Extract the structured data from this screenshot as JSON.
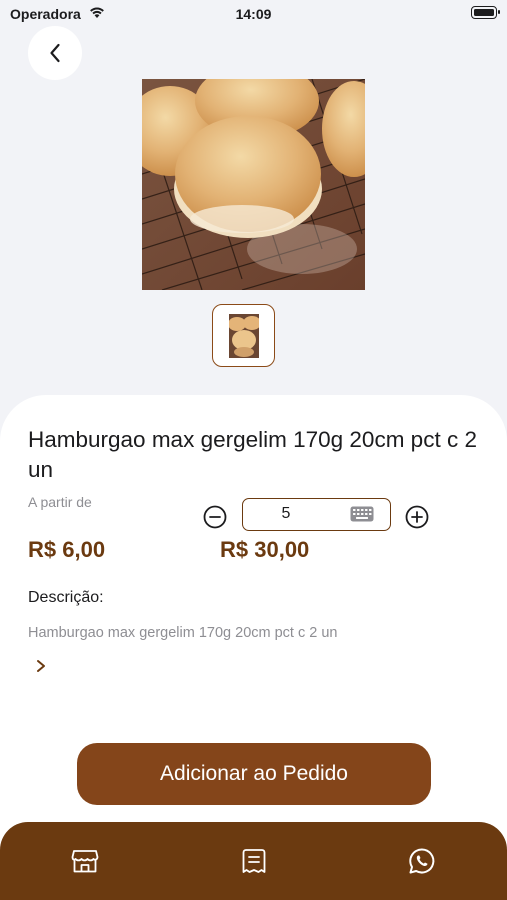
{
  "status_bar": {
    "carrier": "Operadora",
    "time": "14:09",
    "icons": [
      "wifi-icon",
      "battery-icon"
    ]
  },
  "header": {
    "back_icon": "chevron-left-icon"
  },
  "product": {
    "image": "bread-rolls-photo",
    "thumbnail": "bread-rolls-thumbnail",
    "title": "Hamburgao max  gergelim 170g 20cm pct c 2 un",
    "price_prefix": "A partir de",
    "unit_price": "R$ 6,00",
    "total_price": "R$ 30,00"
  },
  "quantity": {
    "value": "5",
    "decrement_icon": "minus-circle-icon",
    "increment_icon": "plus-circle-icon",
    "keyboard_icon": "keyboard-icon"
  },
  "description": {
    "label": "Descrição:",
    "text": "Hamburgao max  gergelim 170g 20cm pct c 2 un",
    "expand_icon": "chevron-right-icon"
  },
  "actions": {
    "add_to_order_label": "Adicionar ao Pedido"
  },
  "bottom_nav": {
    "items": [
      {
        "icon": "store-icon"
      },
      {
        "icon": "receipt-icon"
      },
      {
        "icon": "whatsapp-icon"
      }
    ]
  },
  "colors": {
    "brand_brown": "#6b3a10",
    "button_brown": "#84451a",
    "background": "#f2f3f7",
    "muted_text": "#8e8e93"
  }
}
